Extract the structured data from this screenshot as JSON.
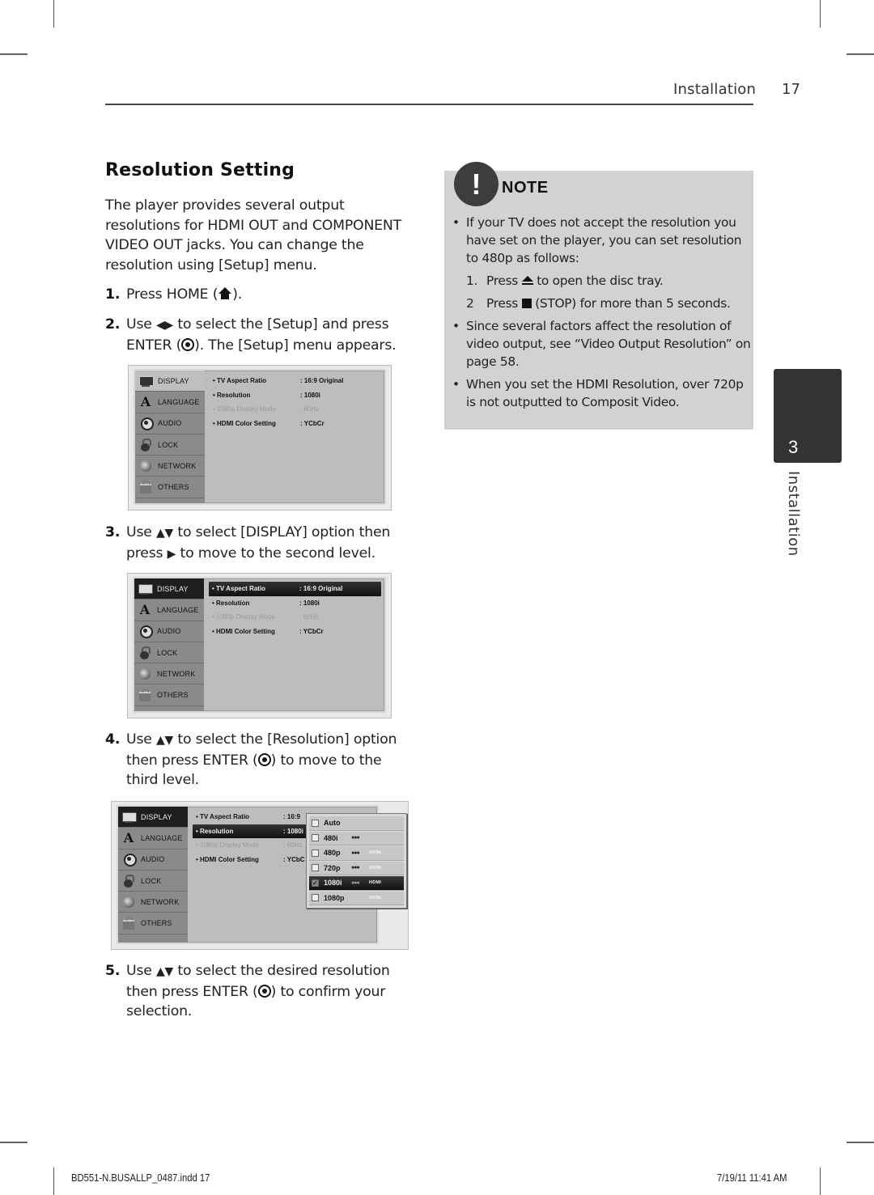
{
  "header": {
    "section": "Installation",
    "page_number": "17"
  },
  "main": {
    "title": "Resolution Setting",
    "intro": "The player provides several output resolutions for HDMI OUT and COMPONENT VIDEO OUT jacks. You can change the resolution using [Setup] menu.",
    "steps": [
      {
        "num": "1.",
        "before": "Press HOME (",
        "icon": "home-icon",
        "after": ")."
      },
      {
        "num": "2.",
        "before": "Use ",
        "glyph": "◀▶",
        "middle": " to select the [Setup] and press ENTER (",
        "icon": "enter-icon",
        "after": "). The [Setup] menu appears."
      },
      {
        "num": "3.",
        "before": "Use ",
        "glyph": "▲▼",
        "middle": " to select [DISPLAY] option then press ",
        "glyph2": "▶",
        "after": " to move to the second level."
      },
      {
        "num": "4.",
        "before": "Use ",
        "glyph": "▲▼",
        "middle": " to select the [Resolution] option then press ENTER (",
        "icon": "enter-icon",
        "after": ") to move to the third level."
      },
      {
        "num": "5.",
        "before": "Use ",
        "glyph": "▲▼",
        "middle": " to select the desired resolution then press ENTER (",
        "icon": "enter-icon",
        "after": ") to confirm your selection."
      }
    ]
  },
  "setup_menu": {
    "sidebar": [
      {
        "label": "DISPLAY",
        "icon": "display-icon"
      },
      {
        "label": "LANGUAGE",
        "icon": "language-icon",
        "glyph": "A"
      },
      {
        "label": "AUDIO",
        "icon": "audio-icon"
      },
      {
        "label": "LOCK",
        "icon": "lock-icon"
      },
      {
        "label": "NETWORK",
        "icon": "network-icon"
      },
      {
        "label": "OTHERS",
        "icon": "others-icon"
      }
    ],
    "options": [
      {
        "label": "• TV Aspect Ratio",
        "value": ": 16:9 Original"
      },
      {
        "label": "• Resolution",
        "value": ": 1080i"
      },
      {
        "label": "• 1080p Display Mode",
        "value": ": 60Hz",
        "disabled": true
      },
      {
        "label": "• HDMI Color Setting",
        "value": ": YCbCr"
      }
    ],
    "shot3_values": [
      ": 16:9",
      ": 1080i",
      ": 60Hz",
      ": YCbC"
    ],
    "resolution_popup": [
      {
        "label": "Auto",
        "component": "",
        "hdmi": "",
        "checked": false
      },
      {
        "label": "480i",
        "component": "●●●",
        "hdmi": "",
        "checked": false
      },
      {
        "label": "480p",
        "component": "●●●",
        "hdmi": "HDMI",
        "checked": false
      },
      {
        "label": "720p",
        "component": "●●●",
        "hdmi": "HDMI",
        "checked": false
      },
      {
        "label": "1080i",
        "component": "●●●",
        "hdmi": "HDMI",
        "checked": true
      },
      {
        "label": "1080p",
        "component": "",
        "hdmi": "HDMI",
        "checked": false
      }
    ],
    "checkmark": "✓"
  },
  "note": {
    "badge": "!",
    "title": "NOTE",
    "bullet": "•",
    "items": [
      {
        "text": "If your TV does not accept the resolution you have set on the player, you can set resolution to 480p as follows:"
      },
      {
        "text": "Since several factors affect the resolution of video output, see “Video Output Resolution” on page 58."
      },
      {
        "text": "When you set the HDMI Resolution, over 720p is not outputted to Composit Video."
      }
    ],
    "sub_steps": [
      {
        "num": "1.",
        "before": "Press ",
        "icon": "eject-icon",
        "after": " to open the disc tray."
      },
      {
        "num": "2",
        "before": "Press ",
        "icon": "stop-icon",
        "after": " (STOP) for more than 5 seconds."
      }
    ]
  },
  "chapter_tab": {
    "number": "3",
    "label": "Installation"
  },
  "footer": {
    "file": "BD551-N.BUSALLP_0487.indd   17",
    "datetime": "7/19/11   11:41 AM"
  }
}
